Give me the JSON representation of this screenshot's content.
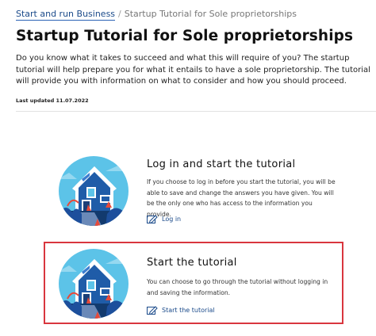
{
  "breadcrumb": {
    "link_label": "Start and run Business",
    "separator": "/",
    "current": "Startup Tutorial for Sole proprietorships"
  },
  "page": {
    "title": "Startup Tutorial for Sole proprietorships",
    "intro": "Do you know what it takes to succeed and what this will require of you? The startup tutorial will help prepare you for what it entails to have a sole proprietorship. The tutorial will provide you with information on what to consider and how you should proceed.",
    "last_updated": "Last updated 11.07.2022"
  },
  "cards": [
    {
      "title": "Log in and start the tutorial",
      "description": "If you choose to log in before you start the tutorial, you will be able to save and change the answers you have given. You will be the only one who has access to the information you provide.",
      "link_label": "Log in"
    },
    {
      "title": "Start the tutorial",
      "description": "You can choose to go through the tutorial without logging in and saving the information.",
      "link_label": "Start the tutorial"
    }
  ],
  "icons": {
    "card_illustration": "house-illustration-icon",
    "card_link": "edit-pencil-icon"
  },
  "colors": {
    "link": "#1a4a8a",
    "highlight_border": "#d9363e",
    "illustration_sky": "#5cc3e8",
    "illustration_house": "#1f5ca8"
  }
}
